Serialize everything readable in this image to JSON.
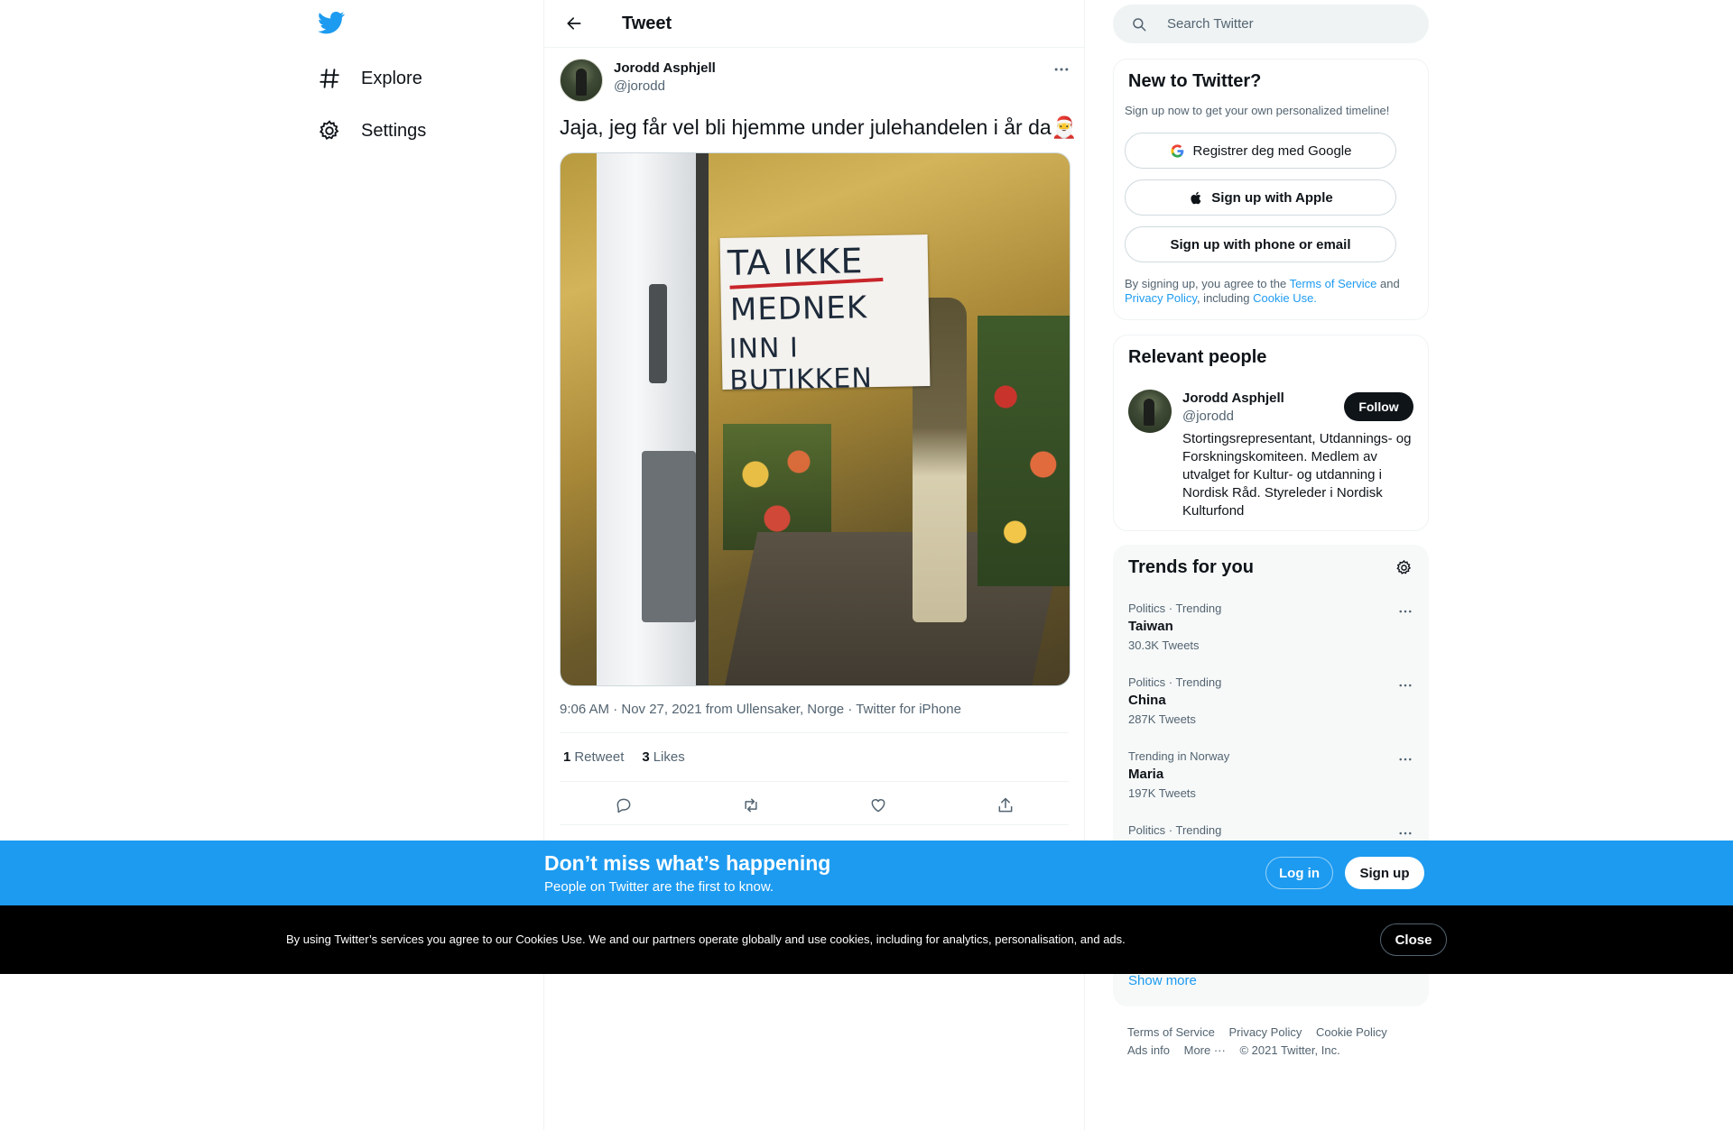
{
  "nav": {
    "logo_icon": "twitter-bird-icon",
    "items": [
      {
        "label": "Explore",
        "icon": "hashtag-icon"
      },
      {
        "label": "Settings",
        "icon": "gear-icon"
      }
    ]
  },
  "header": {
    "title": "Tweet"
  },
  "tweet": {
    "author_name": "Jorodd Asphjell",
    "author_handle": "@jorodd",
    "text": "Jaja, jeg får vel bli hjemme under julehandelen i år da🎅",
    "image_sign": {
      "line1": "TA IKKE",
      "line2": "MEDNEK",
      "line3": "INN I BUTIKKEN"
    },
    "meta": "9:06 AM · Nov 27, 2021 from Ullensaker, Norge · Twitter for iPhone",
    "retweets_count": "1",
    "retweets_label": "Retweet",
    "likes_count": "3",
    "likes_label": "Likes"
  },
  "search": {
    "placeholder": "Search Twitter"
  },
  "new_to_twitter": {
    "title": "New to Twitter?",
    "subtitle": "Sign up now to get your own personalized timeline!",
    "google_button": "Registrer deg med Google",
    "apple_button": "Sign up with Apple",
    "phone_button": "Sign up with phone or email",
    "legal_prefix": "By signing up, you agree to the ",
    "terms_link": "Terms of Service",
    "and": " and ",
    "privacy_link": "Privacy Policy",
    "including": ", including ",
    "cookie_link": "Cookie Use."
  },
  "relevant_people": {
    "title": "Relevant people",
    "name": "Jorodd Asphjell",
    "handle": "@jorodd",
    "follow_label": "Follow",
    "bio": "Stortingsrepresentant, Utdannings- og Forskningskomiteen. Medlem av utvalget for Kultur- og utdanning i Nordisk Råd. Styreleder i Nordisk Kulturfond"
  },
  "trends": {
    "title": "Trends for you",
    "items": [
      {
        "context": "Politics · Trending",
        "topic": "Taiwan",
        "count": "30.3K Tweets"
      },
      {
        "context": "Politics · Trending",
        "topic": "China",
        "count": "287K Tweets"
      },
      {
        "context": "Trending in Norway",
        "topic": "Maria",
        "count": "197K Tweets"
      },
      {
        "context": "Politics · Trending",
        "topic": "",
        "count": ""
      }
    ],
    "show_more": "Show more"
  },
  "footer": {
    "links": [
      "Terms of Service",
      "Privacy Policy",
      "Cookie Policy",
      "Ads info",
      "More ···",
      "© 2021 Twitter, Inc."
    ]
  },
  "banner": {
    "headline": "Don’t miss what’s happening",
    "subline": "People on Twitter are the first to know.",
    "login": "Log in",
    "signup": "Sign up"
  },
  "cookie": {
    "text": "By using Twitter’s services you agree to our Cookies Use. We and our partners operate globally and use cookies, including for analytics, personalisation, and ads.",
    "close": "Close"
  },
  "colors": {
    "accent": "#1d9bf0",
    "text": "#0f1419",
    "secondary": "#536471"
  }
}
